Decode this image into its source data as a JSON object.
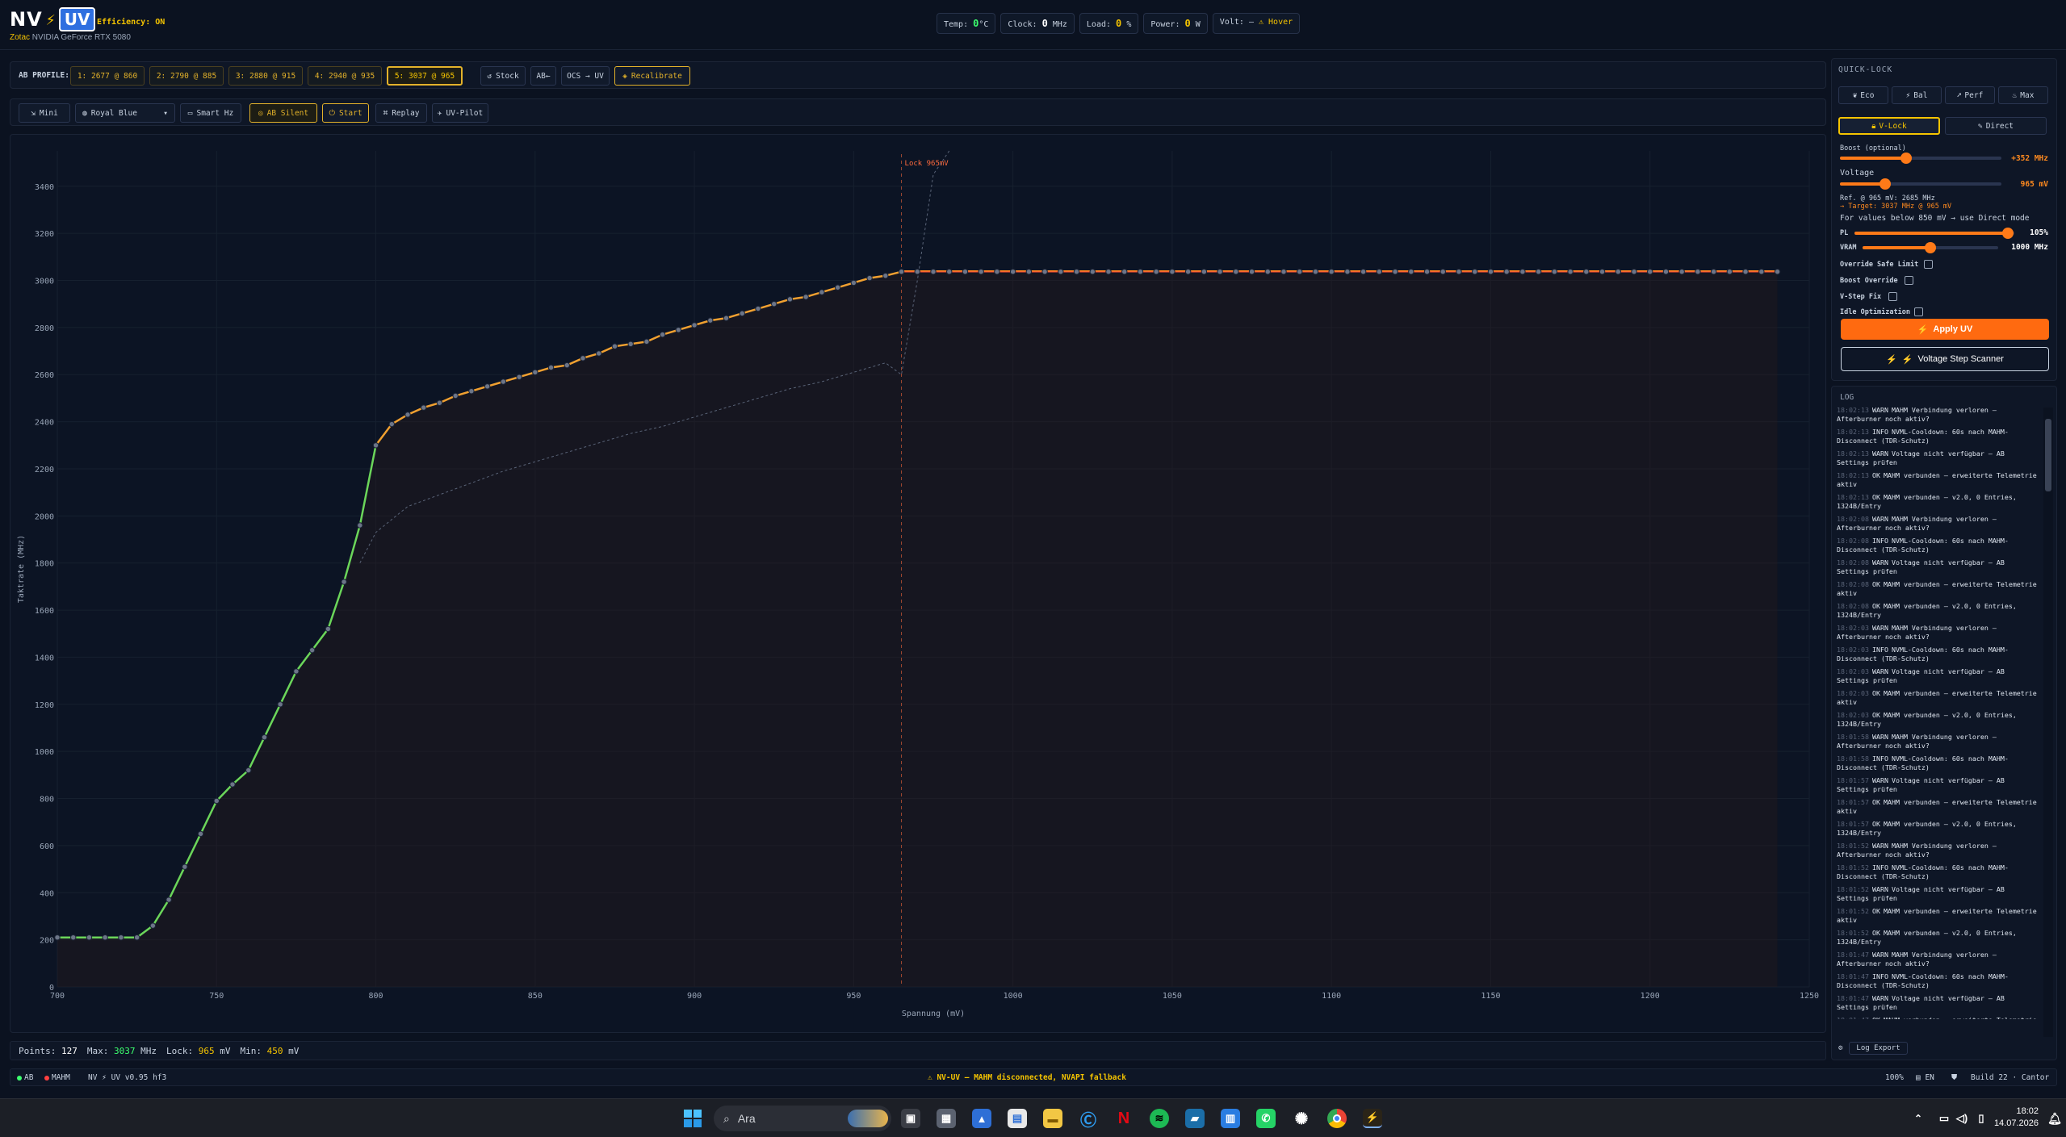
{
  "header": {
    "logo": {
      "nv": "NV",
      "uv": "UV"
    },
    "efficiency": "Efficiency: ON",
    "gpu_vendor": "Zotac",
    "gpu_name": "NVIDIA GeForce RTX 5080",
    "stats": {
      "temp_label": "Temp:",
      "temp_value": "0",
      "temp_unit": "°C",
      "clock_label": "Clock:",
      "clock_value": "0",
      "clock_unit": "MHz",
      "load_label": "Load:",
      "load_value": "0",
      "load_unit": "%",
      "power_label": "Power:",
      "power_value": "0",
      "power_unit": "W",
      "volt_label": "Volt:",
      "volt_value": "—",
      "volt_hover": "⚠ Hover"
    }
  },
  "toolbar1": {
    "ab_profile_label": "AB PROFILE:",
    "profiles": [
      "1: 2677 @ 860",
      "2: 2790 @ 885",
      "3: 2880 @ 915",
      "4: 2940 @ 935",
      "5: 3037 @ 965"
    ],
    "stock": "Stock",
    "ab_arrow": "AB←",
    "ocs_uv": "OCS → UV",
    "recalibrate": "Recalibrate"
  },
  "toolbar2": {
    "mini": "Mini",
    "theme": "Royal Blue",
    "smart_hz": "Smart Hz",
    "ab_silent": "AB Silent",
    "start": "Start",
    "replay": "Replay",
    "uv_pilot": "UV-Pilot"
  },
  "chart_data": {
    "type": "line",
    "xlabel": "Spannung (mV)",
    "ylabel": "Taktrate (MHz)",
    "xlim": [
      700,
      1250
    ],
    "ylim": [
      0,
      3550
    ],
    "x_ticks": [
      700,
      750,
      800,
      850,
      900,
      950,
      1000,
      1050,
      1100,
      1150,
      1200,
      1250
    ],
    "y_ticks": [
      0,
      200,
      400,
      600,
      800,
      1000,
      1200,
      1400,
      1600,
      1800,
      2000,
      2200,
      2400,
      2600,
      2800,
      3000,
      3200,
      3400
    ],
    "lock_label": "Lock 965mV",
    "lock_x": 965,
    "series": [
      {
        "curve": "curve",
        "x": [
          700,
          705,
          710,
          715,
          720,
          725,
          730,
          735,
          740,
          745,
          750,
          755,
          760,
          765,
          770,
          775,
          780,
          785,
          790,
          795,
          800,
          805,
          810,
          815,
          820,
          825,
          830,
          835,
          840,
          845,
          850,
          855,
          860,
          865,
          870,
          875,
          880,
          885,
          890,
          895,
          900,
          905,
          910,
          915,
          920,
          925,
          930,
          935,
          940,
          945,
          950,
          955,
          960,
          965,
          970,
          975,
          980,
          985,
          990,
          995,
          1000,
          1005,
          1010,
          1015,
          1020,
          1025,
          1030,
          1035,
          1040,
          1045,
          1050,
          1055,
          1060,
          1065,
          1070,
          1075,
          1080,
          1085,
          1090,
          1095,
          1100,
          1105,
          1110,
          1115,
          1120,
          1125,
          1130,
          1135,
          1140,
          1145,
          1150,
          1155,
          1160,
          1165,
          1170,
          1175,
          1180,
          1185,
          1190,
          1195,
          1200,
          1205,
          1210,
          1215,
          1220,
          1225,
          1230,
          1235,
          1240
        ],
        "y": [
          210,
          210,
          210,
          210,
          210,
          210,
          260,
          370,
          510,
          650,
          790,
          860,
          920,
          1060,
          1200,
          1340,
          1430,
          1520,
          1720,
          1960,
          2300,
          2390,
          2430,
          2460,
          2480,
          2510,
          2530,
          2550,
          2570,
          2590,
          2610,
          2630,
          2640,
          2670,
          2690,
          2720,
          2730,
          2740,
          2770,
          2790,
          2810,
          2830,
          2840,
          2860,
          2880,
          2900,
          2920,
          2930,
          2950,
          2970,
          2990,
          3010,
          3020,
          3037,
          3037,
          3037,
          3037,
          3037,
          3037,
          3037,
          3037,
          3037,
          3037,
          3037,
          3037,
          3037,
          3037,
          3037,
          3037,
          3037,
          3037,
          3037,
          3037,
          3037,
          3037,
          3037,
          3037,
          3037,
          3037,
          3037,
          3037,
          3037,
          3037,
          3037,
          3037,
          3037,
          3037,
          3037,
          3037,
          3037,
          3037,
          3037,
          3037,
          3037,
          3037,
          3037,
          3037,
          3037,
          3037,
          3037,
          3037,
          3037,
          3037,
          3037,
          3037,
          3037,
          3037,
          3037,
          3037
        ]
      },
      {
        "curve": "stock-reference",
        "x": [
          795,
          800,
          810,
          820,
          830,
          840,
          850,
          860,
          870,
          880,
          890,
          900,
          910,
          920,
          930,
          940,
          950,
          960,
          965,
          970,
          975,
          980
        ],
        "y": [
          1800,
          1930,
          2040,
          2090,
          2140,
          2190,
          2230,
          2270,
          2310,
          2350,
          2380,
          2420,
          2460,
          2500,
          2540,
          2570,
          2610,
          2650,
          2600,
          3000,
          3450,
          3550
        ]
      }
    ]
  },
  "chart_footer": {
    "points_label": "Points:",
    "points": "127",
    "max_label": "Max:",
    "max_value": "3037",
    "max_unit": "MHz",
    "lock_label": "Lock:",
    "lock_value": "965",
    "lock_unit": "mV",
    "min_label": "Min:",
    "min_value": "450",
    "min_unit": "mV"
  },
  "quicklock": {
    "title": "QUICK-LOCK",
    "presets": [
      "Eco",
      "Bal",
      "Perf",
      "Max"
    ],
    "mode_vlock": "V-Lock",
    "mode_direct": "Direct",
    "boost_label": "Boost (optional)",
    "boost_value": "+352 MHz",
    "boost_level": 0.41,
    "voltage_label": "Voltage",
    "voltage_value": "965 mV",
    "voltage_level": 0.28,
    "ref_text": "Ref. @ 965 mV: 2685 MHz",
    "target_text": "→ Target: 3037 MHz @ 965 mV",
    "hint_text": "For values below 850 mV → use Direct mode",
    "pl_label": "PL",
    "pl_value": "105%",
    "pl_level": 0.96,
    "vram_label": "VRAM",
    "vram_value": "1000 MHz",
    "vram_level": 0.5,
    "override_safe": "Override Safe Limit",
    "boost_override": "Boost Override",
    "vstep_fix": "V-Step Fix",
    "idle_opt": "Idle Optimization",
    "apply": "Apply UV",
    "scanner": "Voltage Step Scanner"
  },
  "log": {
    "title": "LOG",
    "export": "Log Export",
    "entries": [
      {
        "time": "18:02:13",
        "level": "WARN",
        "text": "MAHM Verbindung verloren — Afterburner noch aktiv?"
      },
      {
        "time": "18:02:13",
        "level": "INFO",
        "text": "NVML-Cooldown: 60s nach MAHM-Disconnect (TDR-Schutz)"
      },
      {
        "time": "18:02:13",
        "level": "WARN",
        "text": "Voltage nicht verfügbar — AB Settings prüfen"
      },
      {
        "time": "18:02:13",
        "level": "OK",
        "text": "MAHM verbunden — erweiterte Telemetrie aktiv"
      },
      {
        "time": "18:02:13",
        "level": "OK",
        "text": "MAHM verbunden — v2.0, 0 Entries, 1324B/Entry"
      },
      {
        "time": "18:02:08",
        "level": "WARN",
        "text": "MAHM Verbindung verloren — Afterburner noch aktiv?"
      },
      {
        "time": "18:02:08",
        "level": "INFO",
        "text": "NVML-Cooldown: 60s nach MAHM-Disconnect (TDR-Schutz)"
      },
      {
        "time": "18:02:08",
        "level": "WARN",
        "text": "Voltage nicht verfügbar — AB Settings prüfen"
      },
      {
        "time": "18:02:08",
        "level": "OK",
        "text": "MAHM verbunden — erweiterte Telemetrie aktiv"
      },
      {
        "time": "18:02:08",
        "level": "OK",
        "text": "MAHM verbunden — v2.0, 0 Entries, 1324B/Entry"
      },
      {
        "time": "18:02:03",
        "level": "WARN",
        "text": "MAHM Verbindung verloren — Afterburner noch aktiv?"
      },
      {
        "time": "18:02:03",
        "level": "INFO",
        "text": "NVML-Cooldown: 60s nach MAHM-Disconnect (TDR-Schutz)"
      },
      {
        "time": "18:02:03",
        "level": "WARN",
        "text": "Voltage nicht verfügbar — AB Settings prüfen"
      },
      {
        "time": "18:02:03",
        "level": "OK",
        "text": "MAHM verbunden — erweiterte Telemetrie aktiv"
      },
      {
        "time": "18:02:03",
        "level": "OK",
        "text": "MAHM verbunden — v2.0, 0 Entries, 1324B/Entry"
      },
      {
        "time": "18:01:58",
        "level": "WARN",
        "text": "MAHM Verbindung verloren — Afterburner noch aktiv?"
      },
      {
        "time": "18:01:58",
        "level": "INFO",
        "text": "NVML-Cooldown: 60s nach MAHM-Disconnect (TDR-Schutz)"
      },
      {
        "time": "18:01:57",
        "level": "WARN",
        "text": "Voltage nicht verfügbar — AB Settings prüfen"
      },
      {
        "time": "18:01:57",
        "level": "OK",
        "text": "MAHM verbunden — erweiterte Telemetrie aktiv"
      },
      {
        "time": "18:01:57",
        "level": "OK",
        "text": "MAHM verbunden — v2.0, 0 Entries, 1324B/Entry"
      },
      {
        "time": "18:01:52",
        "level": "WARN",
        "text": "MAHM Verbindung verloren — Afterburner noch aktiv?"
      },
      {
        "time": "18:01:52",
        "level": "INFO",
        "text": "NVML-Cooldown: 60s nach MAHM-Disconnect (TDR-Schutz)"
      },
      {
        "time": "18:01:52",
        "level": "WARN",
        "text": "Voltage nicht verfügbar — AB Settings prüfen"
      },
      {
        "time": "18:01:52",
        "level": "OK",
        "text": "MAHM verbunden — erweiterte Telemetrie aktiv"
      },
      {
        "time": "18:01:52",
        "level": "OK",
        "text": "MAHM verbunden — v2.0, 0 Entries, 1324B/Entry"
      },
      {
        "time": "18:01:47",
        "level": "WARN",
        "text": "MAHM Verbindung verloren — Afterburner noch aktiv?"
      },
      {
        "time": "18:01:47",
        "level": "INFO",
        "text": "NVML-Cooldown: 60s nach MAHM-Disconnect (TDR-Schutz)"
      },
      {
        "time": "18:01:47",
        "level": "WARN",
        "text": "Voltage nicht verfügbar — AB Settings prüfen"
      },
      {
        "time": "18:01:47",
        "level": "OK",
        "text": "MAHM verbunden — erweiterte Telemetrie aktiv"
      }
    ]
  },
  "statusbar": {
    "ab": "AB",
    "mahm": "MAHM",
    "version": "NV ⚡ UV v0.95 hf3",
    "warning": "⚠ NV-UV — MAHM disconnected, NVAPI fallback",
    "zoom": "100%",
    "lang": "EN",
    "build": "Build 22 · Cantor",
    "colors": {
      "ab": "#3cff6e",
      "mahm": "#ff4040",
      "warning": "#f5c400"
    }
  },
  "taskbar": {
    "search_placeholder": "Ara",
    "time": "18:02",
    "date": "14.07.2026"
  }
}
